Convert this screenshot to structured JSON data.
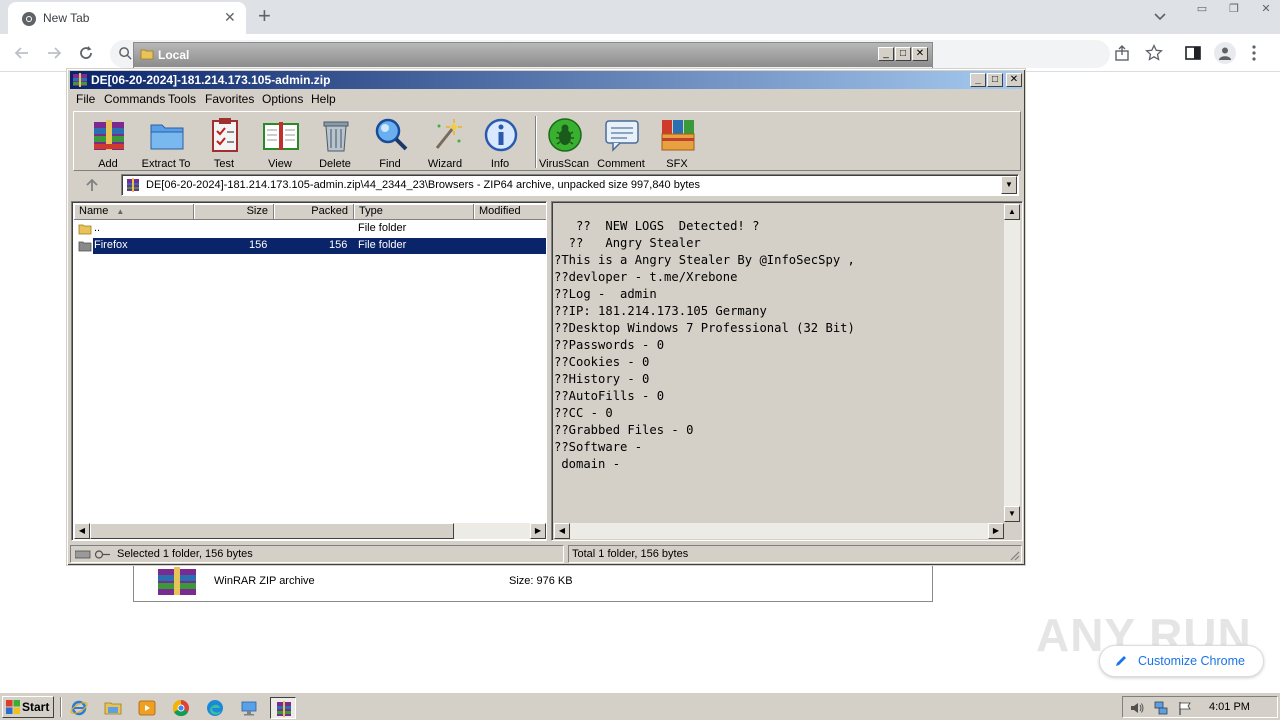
{
  "browser": {
    "tab_title": "New Tab",
    "customize_label": "Customize Chrome",
    "watermark": "ANY RUN"
  },
  "explorer": {
    "title": "Local",
    "file_type": "WinRAR ZIP archive",
    "file_size": "Size: 976 KB"
  },
  "winrar": {
    "title": "DE[06-20-2024]-181.214.173.105-admin.zip",
    "menu": [
      "File",
      "Commands",
      "Tools",
      "Favorites",
      "Options",
      "Help"
    ],
    "toolbar": [
      {
        "label": "Add",
        "icon": "add-archive-icon"
      },
      {
        "label": "Extract To",
        "icon": "extract-folder-icon"
      },
      {
        "label": "Test",
        "icon": "test-clipboard-icon"
      },
      {
        "label": "View",
        "icon": "view-book-icon"
      },
      {
        "label": "Delete",
        "icon": "trash-icon"
      },
      {
        "label": "Find",
        "icon": "magnifier-icon"
      },
      {
        "label": "Wizard",
        "icon": "wand-icon"
      },
      {
        "label": "Info",
        "icon": "info-icon"
      },
      {
        "label": "VirusScan",
        "icon": "bug-icon"
      },
      {
        "label": "Comment",
        "icon": "comment-icon"
      },
      {
        "label": "SFX",
        "icon": "sfx-books-icon"
      }
    ],
    "address": "DE[06-20-2024]-181.214.173.105-admin.zip\\44_2344_23\\Browsers - ZIP64 archive, unpacked size 997,840 bytes",
    "columns": [
      "Name",
      "Size",
      "Packed",
      "Type",
      "Modified"
    ],
    "rows": [
      {
        "name": "..",
        "size": "",
        "packed": "",
        "type": "File folder",
        "modified": ""
      },
      {
        "name": "Firefox",
        "size": "156",
        "packed": "156",
        "type": "File folder",
        "modified": ""
      }
    ],
    "comment_lines": [
      "   ??  NEW LOGS  Detected! ?",
      "  ??   Angry Stealer",
      "?This is a Angry Stealer By @InfoSecSpy ,",
      "??devloper - t.me/Xrebone",
      "??Log -  admin",
      "??IP: 181.214.173.105 Germany",
      "??Desktop Windows 7 Professional (32 Bit)",
      "??Passwords - 0",
      "??Cookies - 0",
      "??History - 0",
      "??AutoFills - 0",
      "??CC - 0",
      "??Grabbed Files - 0",
      "??Software -",
      " domain -"
    ],
    "status_left": "Selected 1 folder, 156 bytes",
    "status_right": "Total 1 folder, 156 bytes"
  },
  "taskbar": {
    "start_label": "Start",
    "clock": "4:01 PM"
  },
  "colors": {
    "title_active": "#0a246a",
    "title_gradient_end": "#a6caf0",
    "selection": "#0a246a",
    "chrome_accent": "#1a73e8"
  }
}
